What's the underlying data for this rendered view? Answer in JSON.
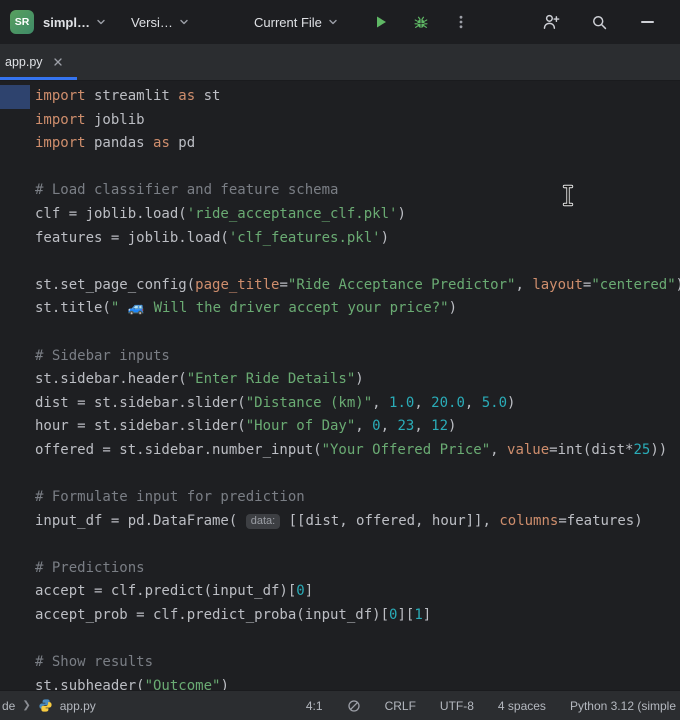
{
  "colors": {
    "accent_blue": "#3574f0",
    "run_green": "#5fb865",
    "syntax_keyword": "#cf8e6d",
    "syntax_string": "#6aab73",
    "syntax_number": "#2aacb8",
    "syntax_comment": "#7a7e85",
    "selection_fragment_blue": "#2e436e",
    "project_avatar_green": "#4f9a5e"
  },
  "icons": {
    "project_chevron": "chevron-down",
    "vcs_chevron": "chevron-down",
    "run_config_chevron": "chevron-down",
    "run": "play-triangle",
    "debug": "bug",
    "more": "kebab-menu",
    "collaborate": "user-plus",
    "search": "magnifier",
    "minimize": "minus",
    "tab_close": "x-cross",
    "breadcrumb_separator": "chevron-right",
    "python_file": "python-logo",
    "inspections": "circle-slash",
    "mouse_pointer": "text-cursor-ibeam"
  },
  "header": {
    "project_avatar": "SR",
    "project_selector": "simpl…",
    "vcs_selector": "Versi…",
    "run_config_selector": "Current File"
  },
  "tabs": [
    {
      "label": "app.py"
    }
  ],
  "editor": {
    "lines": [
      [
        [
          "k",
          "import"
        ],
        [
          "t",
          " streamlit "
        ],
        [
          "k",
          "as"
        ],
        [
          "t",
          " st"
        ]
      ],
      [
        [
          "k",
          "import"
        ],
        [
          "t",
          " joblib"
        ]
      ],
      [
        [
          "k",
          "import"
        ],
        [
          "t",
          " pandas "
        ],
        [
          "k",
          "as"
        ],
        [
          "t",
          " pd"
        ]
      ],
      [],
      [
        [
          "c",
          "# Load classifier and feature schema"
        ]
      ],
      [
        [
          "t",
          "clf = joblib.load("
        ],
        [
          "s",
          "'ride_acceptance_clf.pkl'"
        ],
        [
          "t",
          ")"
        ]
      ],
      [
        [
          "t",
          "features = joblib.load("
        ],
        [
          "s",
          "'clf_features.pkl'"
        ],
        [
          "t",
          ")"
        ]
      ],
      [],
      [
        [
          "t",
          "st.set_page_config("
        ],
        [
          "p",
          "page_title"
        ],
        [
          "t",
          "="
        ],
        [
          "s",
          "\"Ride Acceptance Predictor\""
        ],
        [
          "t",
          ", "
        ],
        [
          "p",
          "layout"
        ],
        [
          "t",
          "="
        ],
        [
          "s",
          "\"centered\""
        ],
        [
          "t",
          ")"
        ]
      ],
      [
        [
          "t",
          "st.title("
        ],
        [
          "s",
          "\" 🚙 Will the driver accept your price?\""
        ],
        [
          "t",
          ")"
        ]
      ],
      [],
      [
        [
          "c",
          "# Sidebar inputs"
        ]
      ],
      [
        [
          "t",
          "st.sidebar.header("
        ],
        [
          "s",
          "\"Enter Ride Details\""
        ],
        [
          "t",
          ")"
        ]
      ],
      [
        [
          "t",
          "dist = st.sidebar.slider("
        ],
        [
          "s",
          "\"Distance (km)\""
        ],
        [
          "t",
          ", "
        ],
        [
          "n",
          "1.0"
        ],
        [
          "t",
          ", "
        ],
        [
          "n",
          "20.0"
        ],
        [
          "t",
          ", "
        ],
        [
          "n",
          "5.0"
        ],
        [
          "t",
          ")"
        ]
      ],
      [
        [
          "t",
          "hour = st.sidebar.slider("
        ],
        [
          "s",
          "\"Hour of Day\""
        ],
        [
          "t",
          ", "
        ],
        [
          "n",
          "0"
        ],
        [
          "t",
          ", "
        ],
        [
          "n",
          "23"
        ],
        [
          "t",
          ", "
        ],
        [
          "n",
          "12"
        ],
        [
          "t",
          ")"
        ]
      ],
      [
        [
          "t",
          "offered = st.sidebar.number_input("
        ],
        [
          "s",
          "\"Your Offered Price\""
        ],
        [
          "t",
          ", "
        ],
        [
          "p",
          "value"
        ],
        [
          "t",
          "=int(dist*"
        ],
        [
          "n",
          "25"
        ],
        [
          "t",
          "))"
        ]
      ],
      [],
      [
        [
          "c",
          "# Formulate input for prediction"
        ]
      ],
      [
        [
          "t",
          "input_df = pd.DataFrame( "
        ],
        [
          "h",
          "data:"
        ],
        [
          "t",
          " [[dist, offered, hour]], "
        ],
        [
          "p",
          "columns"
        ],
        [
          "t",
          "=features)"
        ]
      ],
      [],
      [
        [
          "c",
          "# Predictions"
        ]
      ],
      [
        [
          "t",
          "accept = clf.predict(input_df)["
        ],
        [
          "n",
          "0"
        ],
        [
          "t",
          "]"
        ]
      ],
      [
        [
          "t",
          "accept_prob = clf.predict_proba(input_df)["
        ],
        [
          "n",
          "0"
        ],
        [
          "t",
          "]["
        ],
        [
          "n",
          "1"
        ],
        [
          "t",
          "]"
        ]
      ],
      [],
      [
        [
          "c",
          "# Show results"
        ]
      ],
      [
        [
          "t",
          "st.subheader("
        ],
        [
          "s",
          "\"Outcome\""
        ],
        [
          "t",
          ")"
        ]
      ]
    ]
  },
  "statusbar": {
    "breadcrumbs": [
      "de",
      "app.py"
    ],
    "breadcrumb_separator": "❯",
    "caret_position": "4:1",
    "line_ending": "CRLF",
    "encoding": "UTF-8",
    "indent": "4 spaces",
    "interpreter": "Python 3.12 (simple"
  }
}
